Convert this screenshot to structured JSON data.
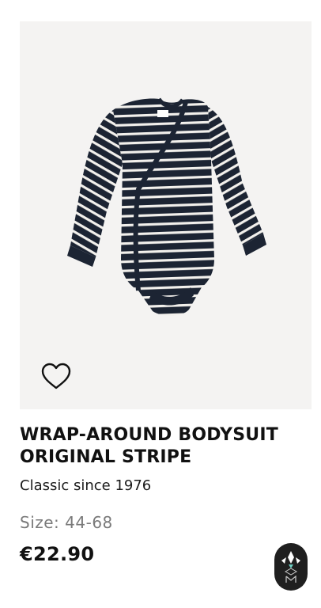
{
  "product": {
    "title": "WRAP-AROUND BODYSUIT ORIGINAL STRIPE",
    "subtitle": "Classic since 1976",
    "size": "Size: 44-68",
    "price": "€22.90",
    "image_icon": "striped-bodysuit-image"
  },
  "icons": {
    "favorite": "heart-outline-icon",
    "brand": "brand-logo-icon"
  },
  "colors": {
    "stripe_navy": "#1c2433",
    "stripe_white": "#f2f0ec",
    "image_background": "#f4f3f2",
    "size_text": "#7a7a7a",
    "badge": "#1f1f1f"
  }
}
